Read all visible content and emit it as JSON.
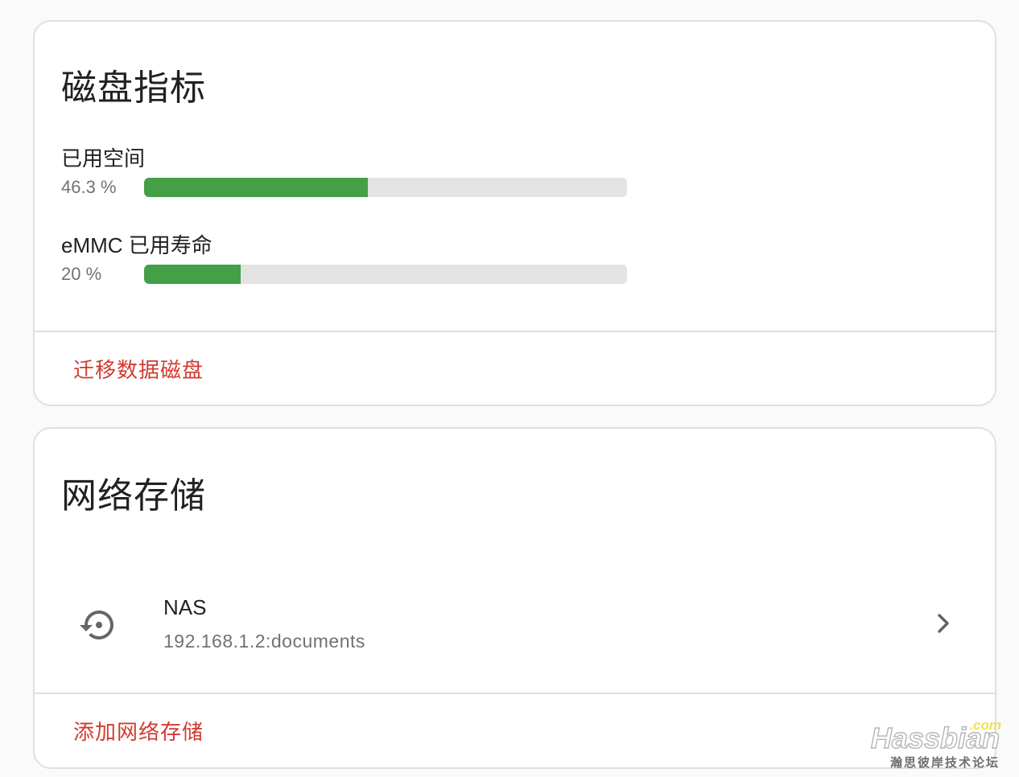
{
  "colors": {
    "accent_red": "#d23b30",
    "bar_green": "#43a047",
    "bar_track": "#e3e3e3",
    "muted_text": "#727272"
  },
  "disk_metrics": {
    "title": "磁盘指标",
    "metrics": [
      {
        "label": "已用空间",
        "value_text": "46.3 %",
        "percent": 46.3
      },
      {
        "label": "eMMC 已用寿命",
        "value_text": "20 %",
        "percent": 20
      }
    ],
    "action_label": "迁移数据磁盘"
  },
  "network_storage": {
    "title": "网络存储",
    "items": [
      {
        "icon": "restore-icon",
        "name": "NAS",
        "address": "192.168.1.2:documents"
      }
    ],
    "action_label": "添加网络存储"
  },
  "watermark": {
    "suffix": ".com",
    "brand": "Hassbian",
    "tagline": "瀚思彼岸技术论坛"
  }
}
